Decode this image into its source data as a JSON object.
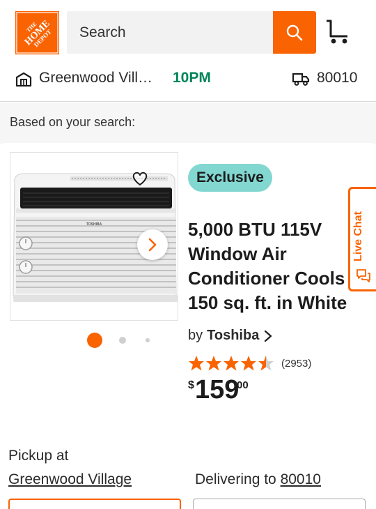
{
  "header": {
    "logo_text": [
      "THE",
      "HOME",
      "DEPOT"
    ],
    "search_placeholder": "Search",
    "brand_color": "#f96302",
    "icons": {
      "search": "search-icon",
      "cart": "cart-icon"
    }
  },
  "store_bar": {
    "store_name": "Greenwood Vill…",
    "hours": "10PM",
    "zip": "80010",
    "hours_color": "#00855a",
    "icons": {
      "store": "store-icon",
      "delivery": "truck-icon"
    }
  },
  "section": {
    "label": "Based on your search:"
  },
  "product": {
    "badge": "Exclusive",
    "badge_color": "#82d7d1",
    "title_lines": [
      "5,000 BTU 115V",
      "Window Air",
      "Conditioner Cools",
      "150 sq. ft. in White"
    ],
    "by_label": "by",
    "brand": "Toshiba",
    "rating": 4.5,
    "reviews": "(2953)",
    "price": {
      "currency": "$",
      "whole": "159",
      "cents": "00"
    },
    "image": {
      "brand_mark": "TOSHIBA",
      "page_count": 3,
      "current_page": 1
    }
  },
  "fulfillment": {
    "pickup_label": "Pickup at",
    "pickup_store": "Greenwood Village",
    "delivering_label": "Delivering to",
    "delivering_zip": "80010"
  },
  "live_chat": {
    "label": "Live Chat",
    "icon": "chat-bubbles-icon"
  }
}
